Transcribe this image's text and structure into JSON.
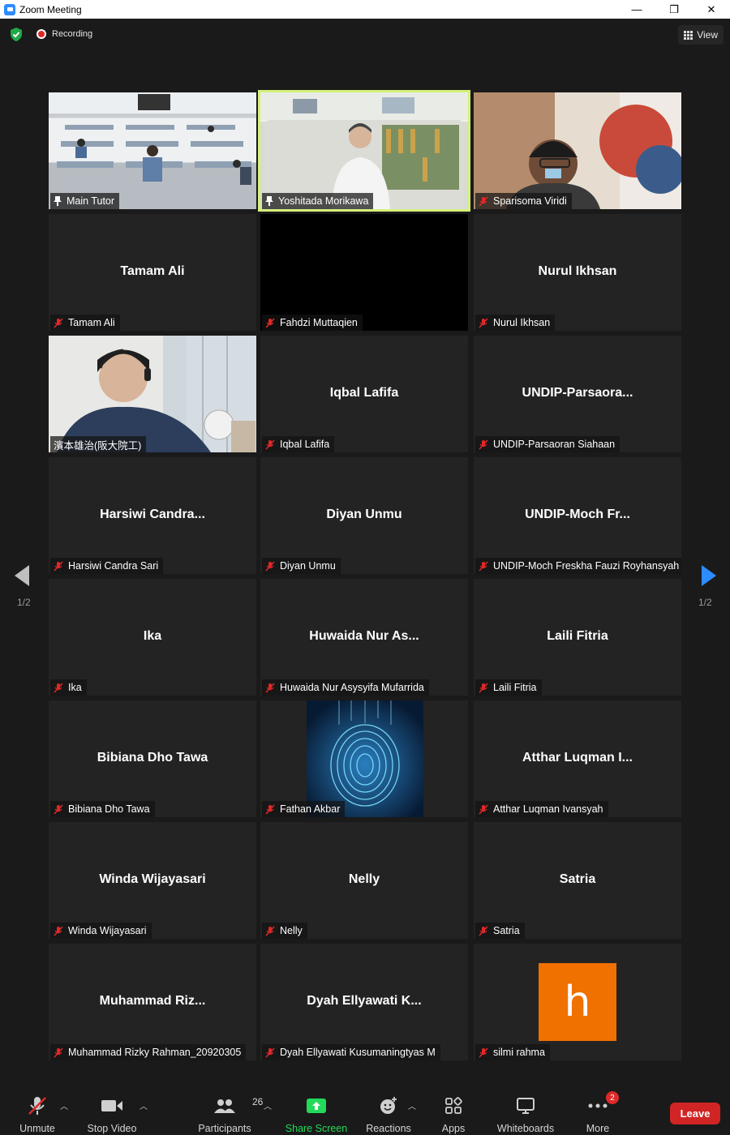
{
  "window": {
    "title": "Zoom Meeting",
    "minimize": "—",
    "restore": "❐",
    "close": "✕"
  },
  "topbar": {
    "recording_label": "Recording",
    "view_label": "View"
  },
  "pagination": {
    "left": "1/2",
    "right": "1/2"
  },
  "tiles": [
    {
      "label": "Main Tutor",
      "center": ""
    },
    {
      "label": "Yoshitada Morikawa",
      "center": ""
    },
    {
      "label": "Sparisoma Viridi",
      "center": ""
    },
    {
      "label": "Tamam Ali",
      "center": "Tamam Ali"
    },
    {
      "label": "Fahdzi Muttaqien",
      "center": ""
    },
    {
      "label": "Nurul Ikhsan",
      "center": "Nurul Ikhsan"
    },
    {
      "label": "濱本雄治(阪大院工)",
      "center": ""
    },
    {
      "label": "Iqbal Lafifa",
      "center": "Iqbal Lafifa"
    },
    {
      "label": "UNDIP-Parsaoran Siahaan",
      "center": "UNDIP-Parsaora..."
    },
    {
      "label": "Harsiwi Candra Sari",
      "center": "Harsiwi  Candra..."
    },
    {
      "label": "Diyan Unmu",
      "center": "Diyan Unmu"
    },
    {
      "label": "UNDIP-Moch Freskha Fauzi Royhansyah",
      "center": "UNDIP-Moch  Fr..."
    },
    {
      "label": "Ika",
      "center": "Ika"
    },
    {
      "label": "Huwaida Nur Asysyifa Mufarrida",
      "center": "Huwaida  Nur  As..."
    },
    {
      "label": "Laili Fitria",
      "center": "Laili Fitria"
    },
    {
      "label": "Bibiana Dho Tawa",
      "center": "Bibiana Dho Tawa"
    },
    {
      "label": "Fathan Akbar",
      "center": ""
    },
    {
      "label": "Atthar Luqman Ivansyah",
      "center": "Atthar  Luqman  I..."
    },
    {
      "label": "Winda Wijayasari",
      "center": "Winda Wijayasari"
    },
    {
      "label": "Nelly",
      "center": "Nelly"
    },
    {
      "label": "Satria",
      "center": "Satria"
    },
    {
      "label": "Muhammad Rizky Rahman_20920305",
      "center": "Muhammad  Riz..."
    },
    {
      "label": "Dyah Ellyawati Kusumaningtyas M",
      "center": "Dyah  Ellyawati  K..."
    },
    {
      "label": "silmi rahma",
      "center": ""
    }
  ],
  "avatar_letter": "h",
  "toolbar": {
    "unmute": "Unmute",
    "stop_video": "Stop Video",
    "participants": "Participants",
    "participants_count": "26",
    "share_screen": "Share Screen",
    "reactions": "Reactions",
    "apps": "Apps",
    "whiteboards": "Whiteboards",
    "more": "More",
    "more_badge": "2",
    "leave": "Leave"
  },
  "colors": {
    "accent_green": "#23d959",
    "leave_red": "#d12424",
    "speaking_outline": "#d4f178",
    "nav_arrow": "#2d8cff",
    "avatar_orange": "#f07000"
  }
}
